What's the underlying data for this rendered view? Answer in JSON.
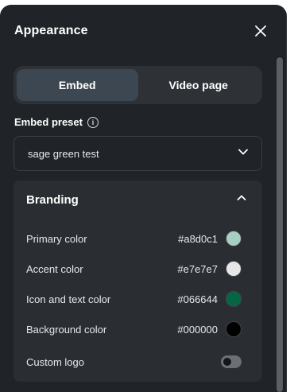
{
  "header": {
    "title": "Appearance"
  },
  "tabs": [
    {
      "label": "Embed",
      "active": true
    },
    {
      "label": "Video page",
      "active": false
    }
  ],
  "embed_preset": {
    "label": "Embed preset",
    "info_icon": "info-icon",
    "selected": "sage green test"
  },
  "branding": {
    "title": "Branding",
    "expanded": true,
    "rows": [
      {
        "label": "Primary color",
        "hex": "#a8d0c1",
        "swatch": "#a8d0c1"
      },
      {
        "label": "Accent color",
        "hex": "#e7e7e7",
        "swatch": "#e7e7e7"
      },
      {
        "label": "Icon and text color",
        "hex": "#066644",
        "swatch": "#066644"
      },
      {
        "label": "Background color",
        "hex": "#000000",
        "swatch": "#000000"
      }
    ],
    "custom_logo": {
      "label": "Custom logo",
      "enabled": false
    }
  },
  "colors": {
    "panel_bg": "#202327",
    "active_tab_bg": "#3d4751"
  }
}
